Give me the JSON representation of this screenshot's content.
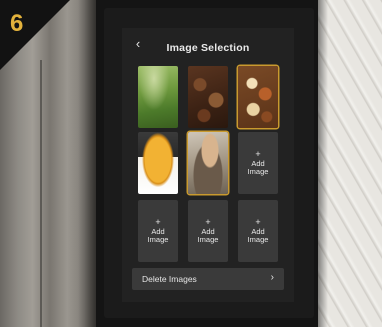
{
  "step_number": "6",
  "screen": {
    "title": "Image Selection",
    "back_icon": "‹",
    "grid": [
      {
        "kind": "image",
        "name": "tea-field",
        "selected": false
      },
      {
        "kind": "image",
        "name": "coffee-beans",
        "selected": false
      },
      {
        "kind": "image",
        "name": "spices",
        "selected": true
      },
      {
        "kind": "image",
        "name": "coffee-cup",
        "selected": false
      },
      {
        "kind": "image",
        "name": "woman-drinking",
        "selected": true
      },
      {
        "kind": "add",
        "plus": "+",
        "label_line1": "Add",
        "label_line2": "Image"
      },
      {
        "kind": "add",
        "plus": "+",
        "label_line1": "Add",
        "label_line2": "Image"
      },
      {
        "kind": "add",
        "plus": "+",
        "label_line1": "Add",
        "label_line2": "Image"
      },
      {
        "kind": "add",
        "plus": "+",
        "label_line1": "Add",
        "label_line2": "Image"
      }
    ],
    "delete_label": "Delete Images",
    "delete_chevron": "›"
  },
  "colors": {
    "accent": "#c99a2e",
    "step_number": "#e3b23c",
    "screen_bg": "#222222",
    "tile_bg": "#3a3a3a"
  }
}
